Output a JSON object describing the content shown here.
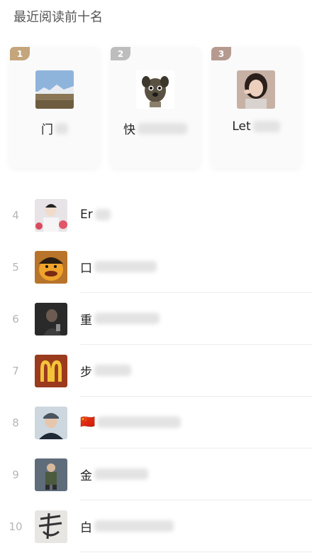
{
  "header": {
    "title": "最近阅读前十名"
  },
  "top3": [
    {
      "rank": "1",
      "name": "门",
      "avatar": "landscape-avatar",
      "tab_color": "#c4a57c"
    },
    {
      "rank": "2",
      "name": "快",
      "avatar": "dog-avatar",
      "tab_color": "#bdbdbd"
    },
    {
      "rank": "3",
      "name": "Let",
      "avatar": "woman-avatar",
      "tab_color": "#b59a8f"
    }
  ],
  "list": [
    {
      "rank": "4",
      "name": "Er",
      "avatar": "man-flowers-avatar"
    },
    {
      "rank": "5",
      "name": "口",
      "avatar": "cartoon-avatar"
    },
    {
      "rank": "6",
      "name": "重",
      "avatar": "dark-portrait-avatar"
    },
    {
      "rank": "7",
      "name": "步",
      "avatar": "mcdonalds-logo-avatar"
    },
    {
      "rank": "8",
      "name": "🇨🇳",
      "avatar": "man-cap-avatar"
    },
    {
      "rank": "9",
      "name": "金",
      "avatar": "figure-avatar"
    },
    {
      "rank": "10",
      "name": "白",
      "avatar": "calligraphy-avatar"
    }
  ]
}
